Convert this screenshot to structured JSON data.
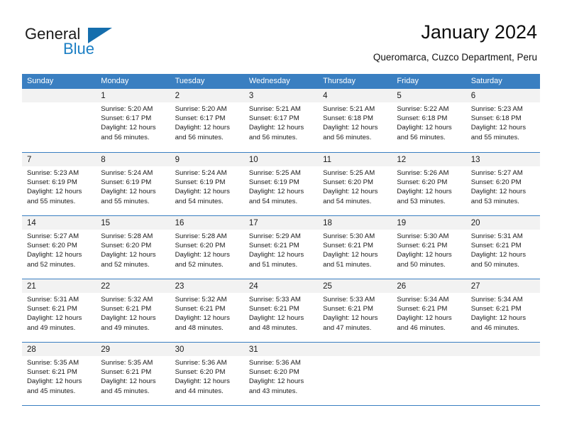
{
  "brand": {
    "name_part1": "General",
    "name_part2": "Blue",
    "triangle_color": "#156ead",
    "blue_color": "#1c7fc4"
  },
  "header": {
    "title": "January 2024",
    "subtitle": "Queromarca, Cuzco Department, Peru"
  },
  "calendar": {
    "header_bg": "#3a7fc1",
    "day_band_bg": "#f2f2f2",
    "weekday_headers": [
      "Sunday",
      "Monday",
      "Tuesday",
      "Wednesday",
      "Thursday",
      "Friday",
      "Saturday"
    ],
    "weeks": [
      [
        {
          "day": "",
          "sunrise": "",
          "sunset": "",
          "daylight_line1": "",
          "daylight_line2": ""
        },
        {
          "day": "1",
          "sunrise": "Sunrise: 5:20 AM",
          "sunset": "Sunset: 6:17 PM",
          "daylight_line1": "Daylight: 12 hours",
          "daylight_line2": "and 56 minutes."
        },
        {
          "day": "2",
          "sunrise": "Sunrise: 5:20 AM",
          "sunset": "Sunset: 6:17 PM",
          "daylight_line1": "Daylight: 12 hours",
          "daylight_line2": "and 56 minutes."
        },
        {
          "day": "3",
          "sunrise": "Sunrise: 5:21 AM",
          "sunset": "Sunset: 6:17 PM",
          "daylight_line1": "Daylight: 12 hours",
          "daylight_line2": "and 56 minutes."
        },
        {
          "day": "4",
          "sunrise": "Sunrise: 5:21 AM",
          "sunset": "Sunset: 6:18 PM",
          "daylight_line1": "Daylight: 12 hours",
          "daylight_line2": "and 56 minutes."
        },
        {
          "day": "5",
          "sunrise": "Sunrise: 5:22 AM",
          "sunset": "Sunset: 6:18 PM",
          "daylight_line1": "Daylight: 12 hours",
          "daylight_line2": "and 56 minutes."
        },
        {
          "day": "6",
          "sunrise": "Sunrise: 5:23 AM",
          "sunset": "Sunset: 6:18 PM",
          "daylight_line1": "Daylight: 12 hours",
          "daylight_line2": "and 55 minutes."
        }
      ],
      [
        {
          "day": "7",
          "sunrise": "Sunrise: 5:23 AM",
          "sunset": "Sunset: 6:19 PM",
          "daylight_line1": "Daylight: 12 hours",
          "daylight_line2": "and 55 minutes."
        },
        {
          "day": "8",
          "sunrise": "Sunrise: 5:24 AM",
          "sunset": "Sunset: 6:19 PM",
          "daylight_line1": "Daylight: 12 hours",
          "daylight_line2": "and 55 minutes."
        },
        {
          "day": "9",
          "sunrise": "Sunrise: 5:24 AM",
          "sunset": "Sunset: 6:19 PM",
          "daylight_line1": "Daylight: 12 hours",
          "daylight_line2": "and 54 minutes."
        },
        {
          "day": "10",
          "sunrise": "Sunrise: 5:25 AM",
          "sunset": "Sunset: 6:19 PM",
          "daylight_line1": "Daylight: 12 hours",
          "daylight_line2": "and 54 minutes."
        },
        {
          "day": "11",
          "sunrise": "Sunrise: 5:25 AM",
          "sunset": "Sunset: 6:20 PM",
          "daylight_line1": "Daylight: 12 hours",
          "daylight_line2": "and 54 minutes."
        },
        {
          "day": "12",
          "sunrise": "Sunrise: 5:26 AM",
          "sunset": "Sunset: 6:20 PM",
          "daylight_line1": "Daylight: 12 hours",
          "daylight_line2": "and 53 minutes."
        },
        {
          "day": "13",
          "sunrise": "Sunrise: 5:27 AM",
          "sunset": "Sunset: 6:20 PM",
          "daylight_line1": "Daylight: 12 hours",
          "daylight_line2": "and 53 minutes."
        }
      ],
      [
        {
          "day": "14",
          "sunrise": "Sunrise: 5:27 AM",
          "sunset": "Sunset: 6:20 PM",
          "daylight_line1": "Daylight: 12 hours",
          "daylight_line2": "and 52 minutes."
        },
        {
          "day": "15",
          "sunrise": "Sunrise: 5:28 AM",
          "sunset": "Sunset: 6:20 PM",
          "daylight_line1": "Daylight: 12 hours",
          "daylight_line2": "and 52 minutes."
        },
        {
          "day": "16",
          "sunrise": "Sunrise: 5:28 AM",
          "sunset": "Sunset: 6:20 PM",
          "daylight_line1": "Daylight: 12 hours",
          "daylight_line2": "and 52 minutes."
        },
        {
          "day": "17",
          "sunrise": "Sunrise: 5:29 AM",
          "sunset": "Sunset: 6:21 PM",
          "daylight_line1": "Daylight: 12 hours",
          "daylight_line2": "and 51 minutes."
        },
        {
          "day": "18",
          "sunrise": "Sunrise: 5:30 AM",
          "sunset": "Sunset: 6:21 PM",
          "daylight_line1": "Daylight: 12 hours",
          "daylight_line2": "and 51 minutes."
        },
        {
          "day": "19",
          "sunrise": "Sunrise: 5:30 AM",
          "sunset": "Sunset: 6:21 PM",
          "daylight_line1": "Daylight: 12 hours",
          "daylight_line2": "and 50 minutes."
        },
        {
          "day": "20",
          "sunrise": "Sunrise: 5:31 AM",
          "sunset": "Sunset: 6:21 PM",
          "daylight_line1": "Daylight: 12 hours",
          "daylight_line2": "and 50 minutes."
        }
      ],
      [
        {
          "day": "21",
          "sunrise": "Sunrise: 5:31 AM",
          "sunset": "Sunset: 6:21 PM",
          "daylight_line1": "Daylight: 12 hours",
          "daylight_line2": "and 49 minutes."
        },
        {
          "day": "22",
          "sunrise": "Sunrise: 5:32 AM",
          "sunset": "Sunset: 6:21 PM",
          "daylight_line1": "Daylight: 12 hours",
          "daylight_line2": "and 49 minutes."
        },
        {
          "day": "23",
          "sunrise": "Sunrise: 5:32 AM",
          "sunset": "Sunset: 6:21 PM",
          "daylight_line1": "Daylight: 12 hours",
          "daylight_line2": "and 48 minutes."
        },
        {
          "day": "24",
          "sunrise": "Sunrise: 5:33 AM",
          "sunset": "Sunset: 6:21 PM",
          "daylight_line1": "Daylight: 12 hours",
          "daylight_line2": "and 48 minutes."
        },
        {
          "day": "25",
          "sunrise": "Sunrise: 5:33 AM",
          "sunset": "Sunset: 6:21 PM",
          "daylight_line1": "Daylight: 12 hours",
          "daylight_line2": "and 47 minutes."
        },
        {
          "day": "26",
          "sunrise": "Sunrise: 5:34 AM",
          "sunset": "Sunset: 6:21 PM",
          "daylight_line1": "Daylight: 12 hours",
          "daylight_line2": "and 46 minutes."
        },
        {
          "day": "27",
          "sunrise": "Sunrise: 5:34 AM",
          "sunset": "Sunset: 6:21 PM",
          "daylight_line1": "Daylight: 12 hours",
          "daylight_line2": "and 46 minutes."
        }
      ],
      [
        {
          "day": "28",
          "sunrise": "Sunrise: 5:35 AM",
          "sunset": "Sunset: 6:21 PM",
          "daylight_line1": "Daylight: 12 hours",
          "daylight_line2": "and 45 minutes."
        },
        {
          "day": "29",
          "sunrise": "Sunrise: 5:35 AM",
          "sunset": "Sunset: 6:21 PM",
          "daylight_line1": "Daylight: 12 hours",
          "daylight_line2": "and 45 minutes."
        },
        {
          "day": "30",
          "sunrise": "Sunrise: 5:36 AM",
          "sunset": "Sunset: 6:20 PM",
          "daylight_line1": "Daylight: 12 hours",
          "daylight_line2": "and 44 minutes."
        },
        {
          "day": "31",
          "sunrise": "Sunrise: 5:36 AM",
          "sunset": "Sunset: 6:20 PM",
          "daylight_line1": "Daylight: 12 hours",
          "daylight_line2": "and 43 minutes."
        },
        {
          "day": "",
          "sunrise": "",
          "sunset": "",
          "daylight_line1": "",
          "daylight_line2": ""
        },
        {
          "day": "",
          "sunrise": "",
          "sunset": "",
          "daylight_line1": "",
          "daylight_line2": ""
        },
        {
          "day": "",
          "sunrise": "",
          "sunset": "",
          "daylight_line1": "",
          "daylight_line2": ""
        }
      ]
    ]
  }
}
